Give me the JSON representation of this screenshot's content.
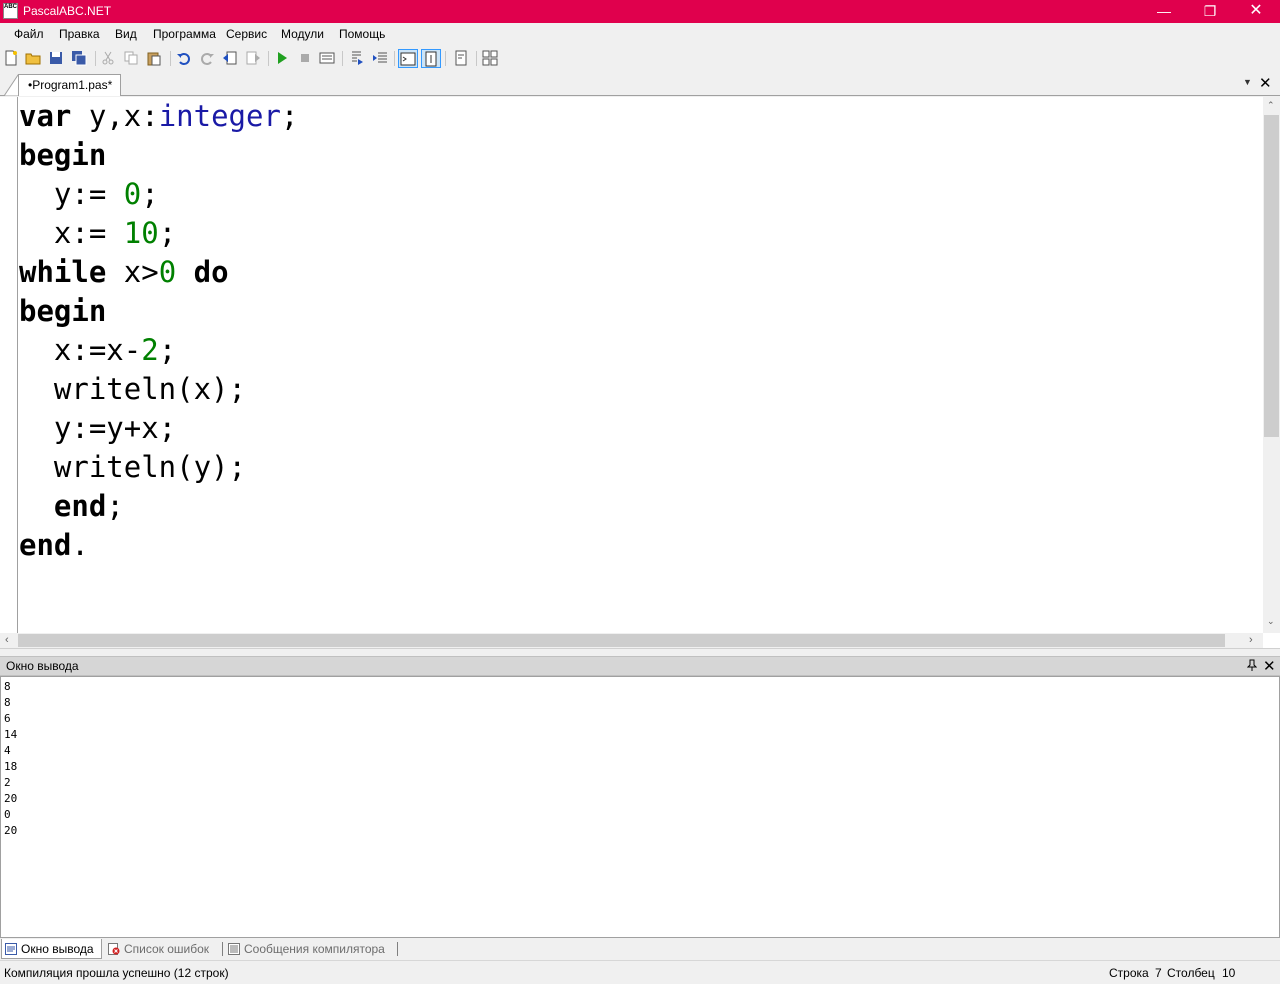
{
  "window": {
    "title": "PascalABC.NET",
    "icon_text": "ABC",
    "minimize": "—",
    "maximize": "❐",
    "close": "✕"
  },
  "menu": {
    "items": [
      "Файл",
      "Правка",
      "Вид",
      "Программа",
      "Сервис",
      "Модули",
      "Помощь"
    ]
  },
  "tabs": {
    "active": "•Program1.pas*",
    "menu_glyph": "▼",
    "close_glyph": "✕"
  },
  "editor": {
    "lines": [
      [
        {
          "t": "var",
          "c": "kw"
        },
        {
          "t": " y,x:",
          "c": ""
        },
        {
          "t": "integer",
          "c": "ty"
        },
        {
          "t": ";",
          "c": ""
        }
      ],
      [
        {
          "t": "begin",
          "c": "kw"
        }
      ],
      [
        {
          "t": "  y:= ",
          "c": ""
        },
        {
          "t": "0",
          "c": "num"
        },
        {
          "t": ";",
          "c": ""
        }
      ],
      [
        {
          "t": "  x:= ",
          "c": ""
        },
        {
          "t": "10",
          "c": "num"
        },
        {
          "t": ";",
          "c": ""
        }
      ],
      [
        {
          "t": "while",
          "c": "kw"
        },
        {
          "t": " x>",
          "c": ""
        },
        {
          "t": "0",
          "c": "num"
        },
        {
          "t": " ",
          "c": ""
        },
        {
          "t": "do",
          "c": "kw"
        }
      ],
      [
        {
          "t": "begin",
          "c": "kw"
        }
      ],
      [
        {
          "t": "  x:=x-",
          "c": ""
        },
        {
          "t": "2",
          "c": "num"
        },
        {
          "t": ";",
          "c": ""
        }
      ],
      [
        {
          "t": "  writeln(x);",
          "c": ""
        }
      ],
      [
        {
          "t": "  y:=y+x;",
          "c": ""
        }
      ],
      [
        {
          "t": "  writeln(y);",
          "c": ""
        }
      ],
      [
        {
          "t": "  ",
          "c": ""
        },
        {
          "t": "end",
          "c": "kw"
        },
        {
          "t": ";",
          "c": ""
        }
      ],
      [
        {
          "t": "end",
          "c": "kw"
        },
        {
          "t": ".",
          "c": ""
        }
      ]
    ]
  },
  "output_panel": {
    "title": "Окно вывода",
    "pin_glyph": "📌",
    "close_glyph": "✕",
    "lines": [
      "8",
      "8",
      "6",
      "14",
      "4",
      "18",
      "2",
      "20",
      "0",
      "20"
    ]
  },
  "bottom_tabs": [
    {
      "label": "Окно вывода",
      "active": true
    },
    {
      "label": "Список ошибок",
      "active": false
    },
    {
      "label": "Сообщения компилятора",
      "active": false
    }
  ],
  "status": {
    "message": "Компиляция прошла успешно (12 строк)",
    "line_label": "Строка",
    "line_value": "7",
    "col_label": "Столбец",
    "col_value": "10"
  },
  "colors": {
    "titlebar": "#e0004d",
    "keyword": "#000000",
    "type": "#1a1aa6",
    "number": "#008000"
  }
}
